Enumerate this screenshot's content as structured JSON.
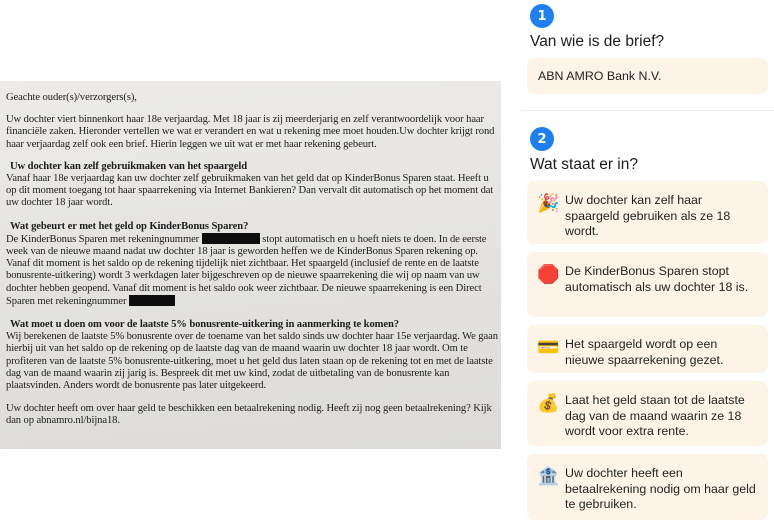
{
  "letter": {
    "salutation": "Geachte ouder(s)/verzorgers(s),",
    "intro": "Uw dochter viert binnenkort haar 18e verjaardag. Met 18 jaar is zij meerderjarig en zelf verantwoordelijk voor haar financiële zaken. Hieronder vertellen we wat er verandert en wat u rekening mee moet houden.Uw dochter krijgt rond haar verjaardag zelf ook een brief. Hierin leggen we uit wat er met haar rekening gebeurt.",
    "sections": [
      {
        "heading": "Uw dochter kan zelf gebruikmaken van het spaargeld",
        "text_before": "Vanaf haar 18e verjaardag kan uw dochter zelf gebruikmaken van het geld dat op KinderBonus Sparen staat. Heeft u op dit moment toegang tot haar spaarrekening via Internet Bankieren? Dan vervalt dit automatisch op het moment dat uw dochter 18 jaar wordt.",
        "text_mid": "",
        "text_after": ""
      },
      {
        "heading": "Wat gebeurt er met het geld op KinderBonus Sparen?",
        "text_before": "De KinderBonus Sparen met rekeningnummer",
        "text_mid": "stopt automatisch en u hoeft niets te doen. In de eerste week van de nieuwe maand nadat uw dochter 18 jaar is geworden heffen we de KinderBonus Sparen rekening op. Vanaf dit moment is het saldo op de rekening tijdelijk niet zichtbaar. Het spaargeld (inclusief de rente en de laatste bonusrente-uitkering) wordt 3 werkdagen later bijgeschreven op de nieuwe spaarrekening die wij op naam van uw dochter hebben geopend. Vanaf dit moment is het saldo ook weer zichtbaar. De nieuwe spaarrekening is een Direct Sparen met rekeningnummer",
        "text_after": ""
      },
      {
        "heading": "Wat moet u doen om voor de laatste 5% bonusrente-uitkering in aanmerking te komen?",
        "text_before": "Wij berekenen de laatste 5% bonusrente over de toename van het saldo sinds uw dochter haar 15e verjaardag. We gaan hierbij uit van het saldo op de rekening op de laatste dag van de maand waarin uw dochter 18 jaar wordt. Om te profiteren van de laatste 5% bonusrente-uitkering, moet u het geld dus laten staan op de rekening tot en met de laatste dag van de maand waarin zij jarig is. Bespreek dit met uw kind, zodat de uitbetaling van de bonusrente kan plaatsvinden. Anders wordt de bonusrente pas later uitgekeerd.",
        "text_mid": "",
        "text_after": ""
      }
    ],
    "closing": "Uw dochter heeft om over haar geld te beschikken een betaalrekening nodig. Heeft zij nog geen betaalrekening? Kijk dan op abnamro.nl/bijna18."
  },
  "panel": {
    "step1": {
      "number": "1",
      "title": "Van wie is de brief?",
      "sender": "ABN AMRO Bank N.V."
    },
    "step2": {
      "number": "2",
      "title": "Wat staat er in?",
      "items": [
        {
          "icon": "🎉",
          "icon_name": "party-popper-icon",
          "text": "Uw dochter kan zelf haar spaargeld gebruiken als ze 18 wordt."
        },
        {
          "icon": "🛑",
          "icon_name": "stop-sign-icon",
          "text": "De KinderBonus Sparen stopt automatisch als uw dochter 18 is."
        },
        {
          "icon": "💳",
          "icon_name": "credit-card-icon",
          "text": "Het spaargeld wordt op een nieuwe spaarrekening gezet."
        },
        {
          "icon": "💰",
          "icon_name": "money-bag-icon",
          "text": "Laat het geld staan tot de laatste dag van de maand waarin ze 18 wordt voor extra rente."
        },
        {
          "icon": "🏦",
          "icon_name": "bank-icon",
          "text": "Uw dochter heeft een betaalrekening nodig om haar geld te gebruiken."
        }
      ]
    }
  },
  "colors": {
    "accent": "#1d7ff2",
    "card_bg": "#fdf3e6"
  }
}
